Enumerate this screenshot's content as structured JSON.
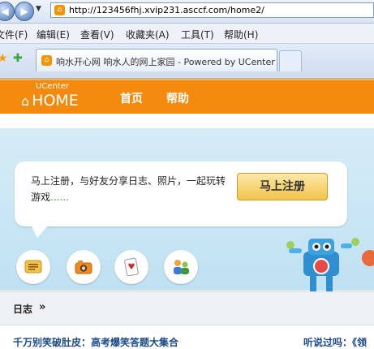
{
  "browser": {
    "url": "http://123456fhj.xvip231.asccf.com/home2/",
    "menu": [
      "文件(F)",
      "编辑(E)",
      "查看(V)",
      "收藏夹(A)",
      "工具(T)",
      "帮助(H)"
    ],
    "tab_title": "响水开心网 响水人的网上家园 - Powered by UCenter Home"
  },
  "site": {
    "logo_top": "UCenter",
    "logo_main": "HOME",
    "nav": [
      "首页",
      "帮助"
    ]
  },
  "banner": {
    "text": "马上注册，与好友分享日志、照片，一起玩转游戏",
    "dots": "......",
    "button": "马上注册"
  },
  "section": {
    "title": "日志",
    "arrow": "»"
  },
  "feed": {
    "item_title": "千万别笑破肚皮：高考爆笑答题大集合",
    "side_text": "听说过吗：《领"
  }
}
